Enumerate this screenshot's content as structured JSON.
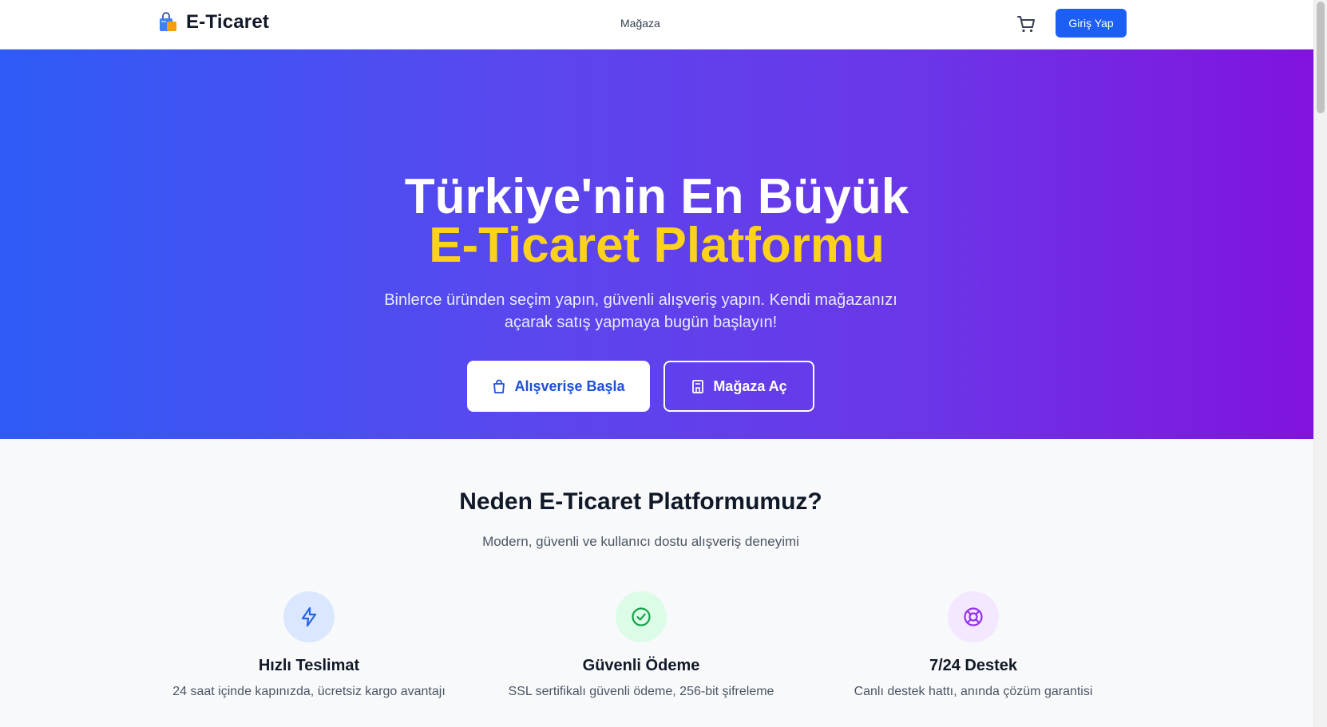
{
  "header": {
    "brand_name": "E-Ticaret",
    "nav_link": "Mağaza",
    "login_label": "Giriş Yap",
    "cart_icon": "cart-icon",
    "brand_icon": "shopping-bag-icon"
  },
  "hero": {
    "title_line1": "Türkiye'nin En Büyük",
    "title_line2": "E-Ticaret Platformu",
    "subtitle": "Binlerce üründen seçim yapın, güvenli alışveriş yapın. Kendi mağazanızı açarak satış yapmaya bugün başlayın!",
    "shop_button": "Alışverişe Başla",
    "store_button": "Mağaza Aç",
    "accent_color": "#fcd21c"
  },
  "why": {
    "title": "Neden E-Ticaret Platformumuz?",
    "subtitle": "Modern, güvenli ve kullanıcı dostu alışveriş deneyimi",
    "features": [
      {
        "title": "Hızlı Teslimat",
        "desc": "24 saat içinde kapınızda, ücretsiz kargo avantajı",
        "icon": "lightning-icon",
        "color": "#2563eb"
      },
      {
        "title": "Güvenli Ödeme",
        "desc": "SSL sertifikalı güvenli ödeme, 256-bit şifreleme",
        "icon": "check-circle-icon",
        "color": "#16a34a"
      },
      {
        "title": "7/24 Destek",
        "desc": "Canlı destek hattı, anında çözüm garantisi",
        "icon": "support-icon",
        "color": "#9333ea"
      }
    ]
  }
}
